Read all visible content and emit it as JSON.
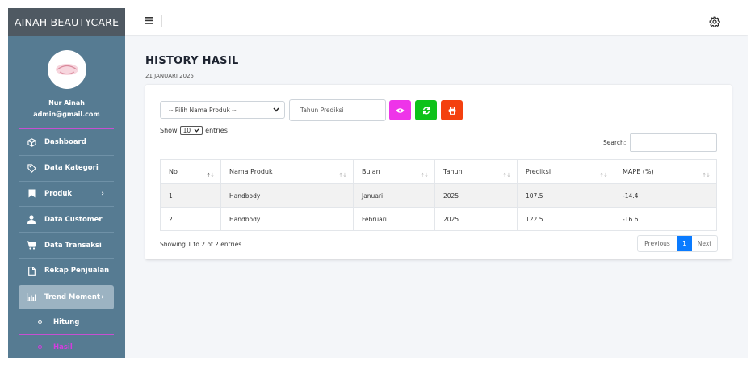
{
  "sidebar": {
    "brand": "AINAH BEAUTYCARE",
    "user_name": "Nur Ainah",
    "user_email": "admin@gmail.com",
    "items": [
      {
        "label": "Dashboard",
        "icon": "cube-icon"
      },
      {
        "label": "Data Kategori",
        "icon": "tag-icon"
      },
      {
        "label": "Produk",
        "icon": "bookmark-icon"
      },
      {
        "label": "Data Customer",
        "icon": "user-icon"
      },
      {
        "label": "Data Transaksi",
        "icon": "cart-icon"
      },
      {
        "label": "Rekap Penjualan",
        "icon": "file-icon"
      },
      {
        "label": "Trend Moment",
        "icon": "bar-chart-icon"
      }
    ],
    "subitems": [
      {
        "label": "Hitung"
      },
      {
        "label": "Hasil"
      }
    ],
    "colors": {
      "background": "#567b92",
      "accent": "#d63be0"
    }
  },
  "page": {
    "title": "HISTORY HASIL",
    "date": "21 JANUARI 2025"
  },
  "filters": {
    "product_select": "-- Pilih Nama Produk --",
    "year_placeholder": "Tahun Prediksi"
  },
  "table": {
    "show_label": "Show",
    "length_value": "10",
    "entries_label": "entries",
    "search_label": "Search:",
    "columns": [
      "No",
      "Nama Produk",
      "Bulan",
      "Tahun",
      "Prediksi",
      "MAPE (%)"
    ],
    "rows": [
      [
        "1",
        "Handbody",
        "Januari",
        "2025",
        "107.5",
        "-14.4"
      ],
      [
        "2",
        "Handbody",
        "Februari",
        "2025",
        "122.5",
        "-16.6"
      ]
    ],
    "info": "Showing 1 to 2 of 2 entries",
    "pagination": {
      "previous": "Previous",
      "current": "1",
      "next": "Next"
    }
  },
  "button_colors": {
    "view": "#ee34e9",
    "refresh": "#0ec21a",
    "print": "#f4400f"
  }
}
